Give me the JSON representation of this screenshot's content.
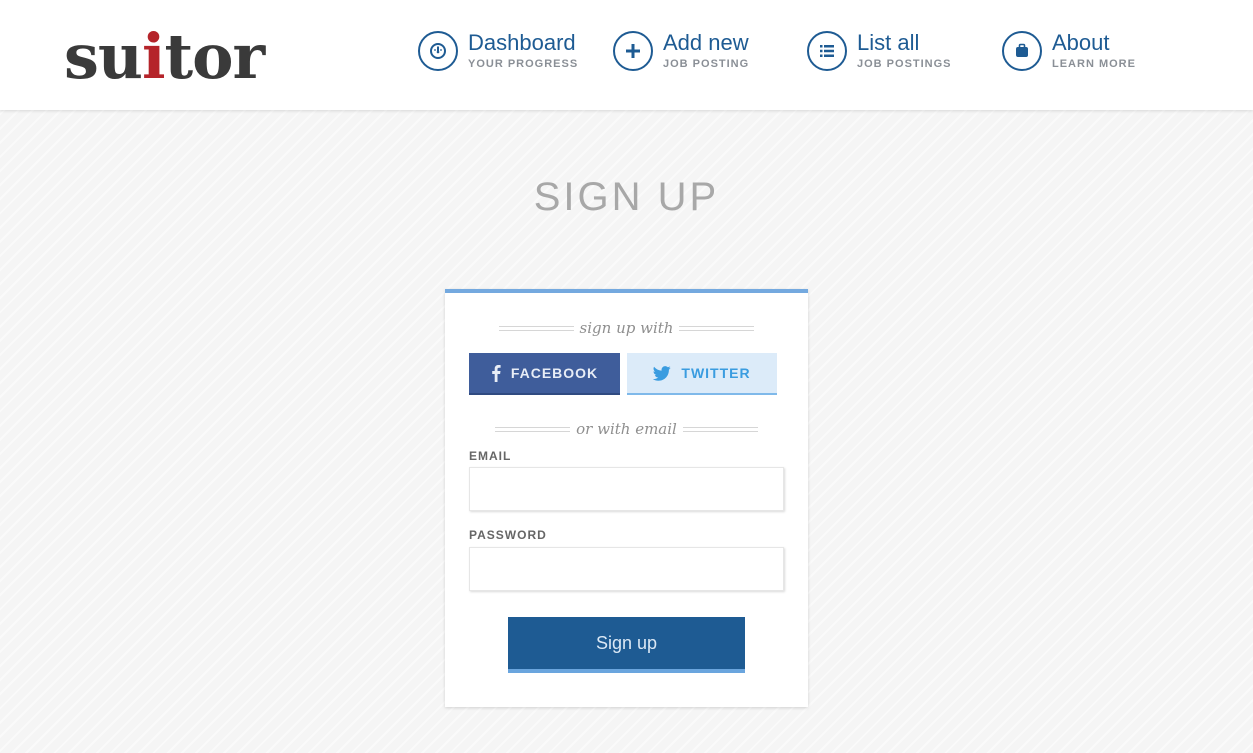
{
  "brand": {
    "name_prefix": "su",
    "name_tie": "i",
    "name_suffix": "tor",
    "tie_color": "#b5242a"
  },
  "nav": [
    {
      "title": "Dashboard",
      "subtitle": "YOUR PROGRESS",
      "icon": "dashboard-gauge-icon"
    },
    {
      "title": "Add new",
      "subtitle": "JOB POSTING",
      "icon": "plus-icon"
    },
    {
      "title": "List all",
      "subtitle": "JOB POSTINGS",
      "icon": "list-icon"
    },
    {
      "title": "About",
      "subtitle": "LEARN MORE",
      "icon": "briefcase-icon"
    }
  ],
  "page": {
    "title": "SIGN UP"
  },
  "form": {
    "social_divider": "sign up with",
    "facebook_label": "FACEBOOK",
    "twitter_label": "TWITTER",
    "email_divider": "or with email",
    "email_label": "EMAIL",
    "email_value": "",
    "password_label": "PASSWORD",
    "password_value": "",
    "submit_label": "Sign up"
  },
  "colors": {
    "primary": "#1e5b93",
    "accent": "#74a9df",
    "facebook": "#3f5d9b",
    "twitter_bg": "#dcebf9"
  }
}
